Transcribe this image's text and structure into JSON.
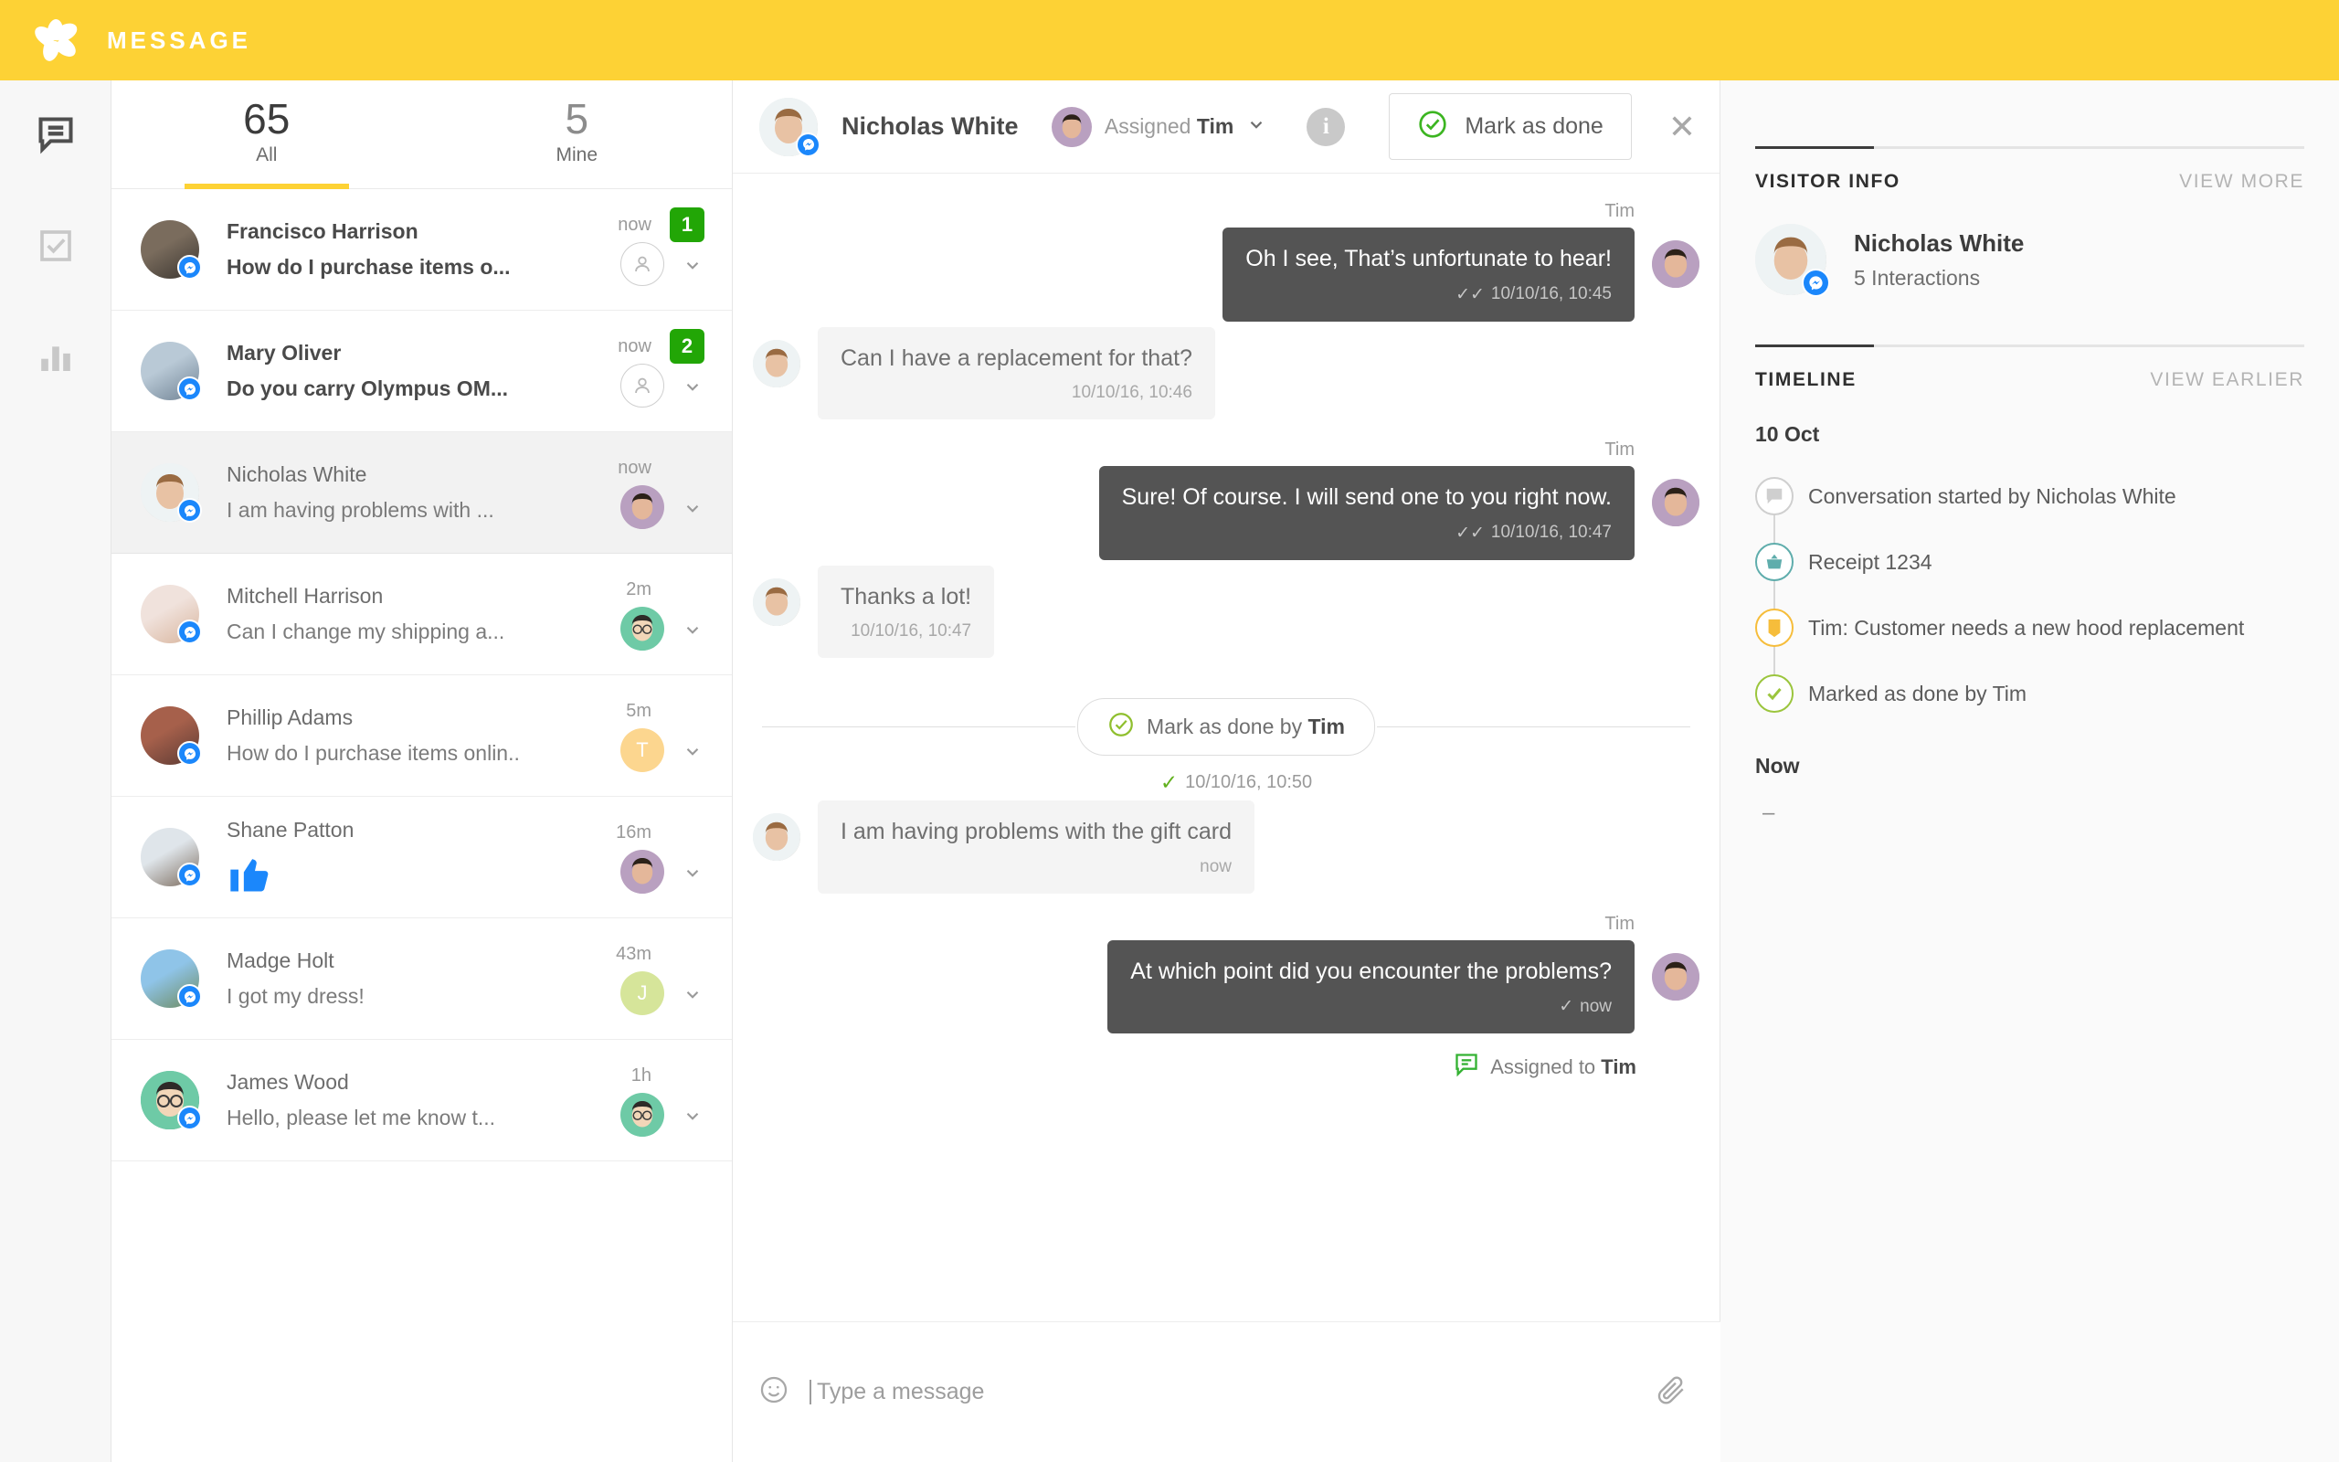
{
  "app": {
    "title": "MESSAGE",
    "brand_color": "#fdd235"
  },
  "rail": {
    "items": [
      {
        "name": "messages",
        "icon": "speech-bubble-icon",
        "active": true
      },
      {
        "name": "tasks",
        "icon": "checkbox-icon",
        "active": false
      },
      {
        "name": "analytics",
        "icon": "bar-chart-icon",
        "active": false
      }
    ]
  },
  "conversation_list": {
    "tabs": [
      {
        "count": "65",
        "label": "All",
        "active": true
      },
      {
        "count": "5",
        "label": "Mine",
        "active": false
      }
    ],
    "items": [
      {
        "name": "Francisco Harrison",
        "preview": "How do I purchase items o...",
        "time": "now",
        "badge": "1",
        "unread": true,
        "selected": false,
        "assignee_type": "none",
        "assignee_label": "",
        "assignee_color": "#ffffff",
        "avatar_colors": [
          "#7a6c5d",
          "#3a3530"
        ]
      },
      {
        "name": "Mary Oliver",
        "preview": "Do you carry Olympus OM...",
        "time": "now",
        "badge": "2",
        "unread": true,
        "selected": false,
        "assignee_type": "none",
        "assignee_label": "",
        "assignee_color": "#ffffff",
        "avatar_colors": [
          "#b9c9d6",
          "#6f8293"
        ]
      },
      {
        "name": "Nicholas White",
        "preview": "I am having problems with ...",
        "time": "now",
        "badge": "",
        "unread": false,
        "selected": true,
        "assignee_type": "photo",
        "assignee_label": "",
        "assignee_color": "#cdb4c4",
        "avatar_colors": [
          "#e7eef0",
          "#a98a6a"
        ]
      },
      {
        "name": "Mitchell Harrison",
        "preview": "Can I change my shipping a...",
        "time": "2m",
        "badge": "",
        "unread": false,
        "selected": false,
        "assignee_type": "emoji",
        "assignee_label": "",
        "assignee_color": "#6ecaa6",
        "avatar_colors": [
          "#f0e2dc",
          "#d8b49c"
        ]
      },
      {
        "name": "Phillip Adams",
        "preview": "How do I purchase items onlin..",
        "time": "5m",
        "badge": "",
        "unread": false,
        "selected": false,
        "assignee_type": "letter",
        "assignee_label": "T",
        "assignee_color": "#fcd68f",
        "avatar_colors": [
          "#a6604b",
          "#5b3a34"
        ]
      },
      {
        "name": "Shane Patton",
        "preview": "",
        "preview_icon": "thumbs-up-icon",
        "time": "16m",
        "badge": "",
        "unread": false,
        "selected": false,
        "assignee_type": "photo",
        "assignee_label": "",
        "assignee_color": "#cdb4c4",
        "avatar_colors": [
          "#dfe5ea",
          "#7a6a5c"
        ]
      },
      {
        "name": "Madge Holt",
        "preview": "I got my dress!",
        "time": "43m",
        "badge": "",
        "unread": false,
        "selected": false,
        "assignee_type": "letter",
        "assignee_label": "J",
        "assignee_color": "#d6e59a",
        "avatar_colors": [
          "#8fc4e8",
          "#6d8a5e"
        ]
      },
      {
        "name": "James Wood",
        "preview": "Hello, please let me know t...",
        "time": "1h",
        "badge": "",
        "unread": false,
        "selected": false,
        "assignee_type": "emoji",
        "assignee_label": "",
        "assignee_color": "#6ecaa6",
        "avatar_colors": [
          "#6ecaa6",
          "#3b3b3b"
        ]
      }
    ]
  },
  "chat": {
    "header": {
      "contact_name": "Nicholas White",
      "assigned_prefix": "Assigned",
      "assigned_to": "Tim",
      "info_glyph": "i",
      "mark_done_label": "Mark as done",
      "close_glyph": "✕"
    },
    "messages": [
      {
        "type": "message",
        "direction": "out",
        "sender": "Tim",
        "text": "Oh I see, That’s unfortunate to hear!",
        "meta": "10/10/16, 10:45",
        "ticks": "✓✓"
      },
      {
        "type": "message",
        "direction": "in",
        "sender": "",
        "text": "Can I have a replacement for that?",
        "meta": "10/10/16, 10:46",
        "ticks": ""
      },
      {
        "type": "message",
        "direction": "out",
        "sender": "Tim",
        "text": "Sure! Of course. I will send one to you right now.",
        "meta": "10/10/16, 10:47",
        "ticks": "✓✓"
      },
      {
        "type": "message",
        "direction": "in",
        "sender": "",
        "text": "Thanks a lot!",
        "meta": "10/10/16, 10:47",
        "ticks": ""
      },
      {
        "type": "divider",
        "pill_prefix": "Mark as done by",
        "pill_actor": "Tim",
        "stamp": "10/10/16, 10:50",
        "stamp_tick": "✓"
      },
      {
        "type": "message",
        "direction": "in",
        "sender": "",
        "text": "I am having problems with the gift card",
        "meta": "now",
        "ticks": ""
      },
      {
        "type": "message",
        "direction": "out",
        "sender": "Tim",
        "text": "At which point did you encounter the problems?",
        "meta": "now",
        "ticks": "✓"
      },
      {
        "type": "assigned_note",
        "text": "Assigned to",
        "actor": "Tim"
      }
    ],
    "composer": {
      "placeholder": "Type a message",
      "emoji_icon": "smiley-icon",
      "attach_icon": "paperclip-icon"
    }
  },
  "right_panel": {
    "visitor_section": {
      "title": "VISITOR INFO",
      "action": "VIEW MORE",
      "name": "Nicholas White",
      "interactions": "5 Interactions"
    },
    "timeline_section": {
      "title": "TIMELINE",
      "action": "VIEW EARLIER",
      "date_group": "10 Oct",
      "items": [
        {
          "icon": "chat-bubble-icon",
          "text": "Conversation started by Nicholas White",
          "color": "#cfcfcf"
        },
        {
          "icon": "basket-icon",
          "text": "Receipt 1234",
          "color": "#5fadac"
        },
        {
          "icon": "note-icon",
          "text": "Tim: Customer needs a new hood replacement",
          "color": "#f6bd3b"
        },
        {
          "icon": "check-circle-icon",
          "text": "Marked as done by Tim",
          "color": "#9bc53d"
        }
      ],
      "now_label": "Now",
      "now_value": "–"
    }
  },
  "colors": {
    "brand_yellow": "#fdd235",
    "badge_green": "#22a606",
    "messenger_blue": "#1b87fb",
    "bubble_out": "#545454",
    "bubble_in": "#f4f4f4",
    "done_green": "#68b825"
  }
}
